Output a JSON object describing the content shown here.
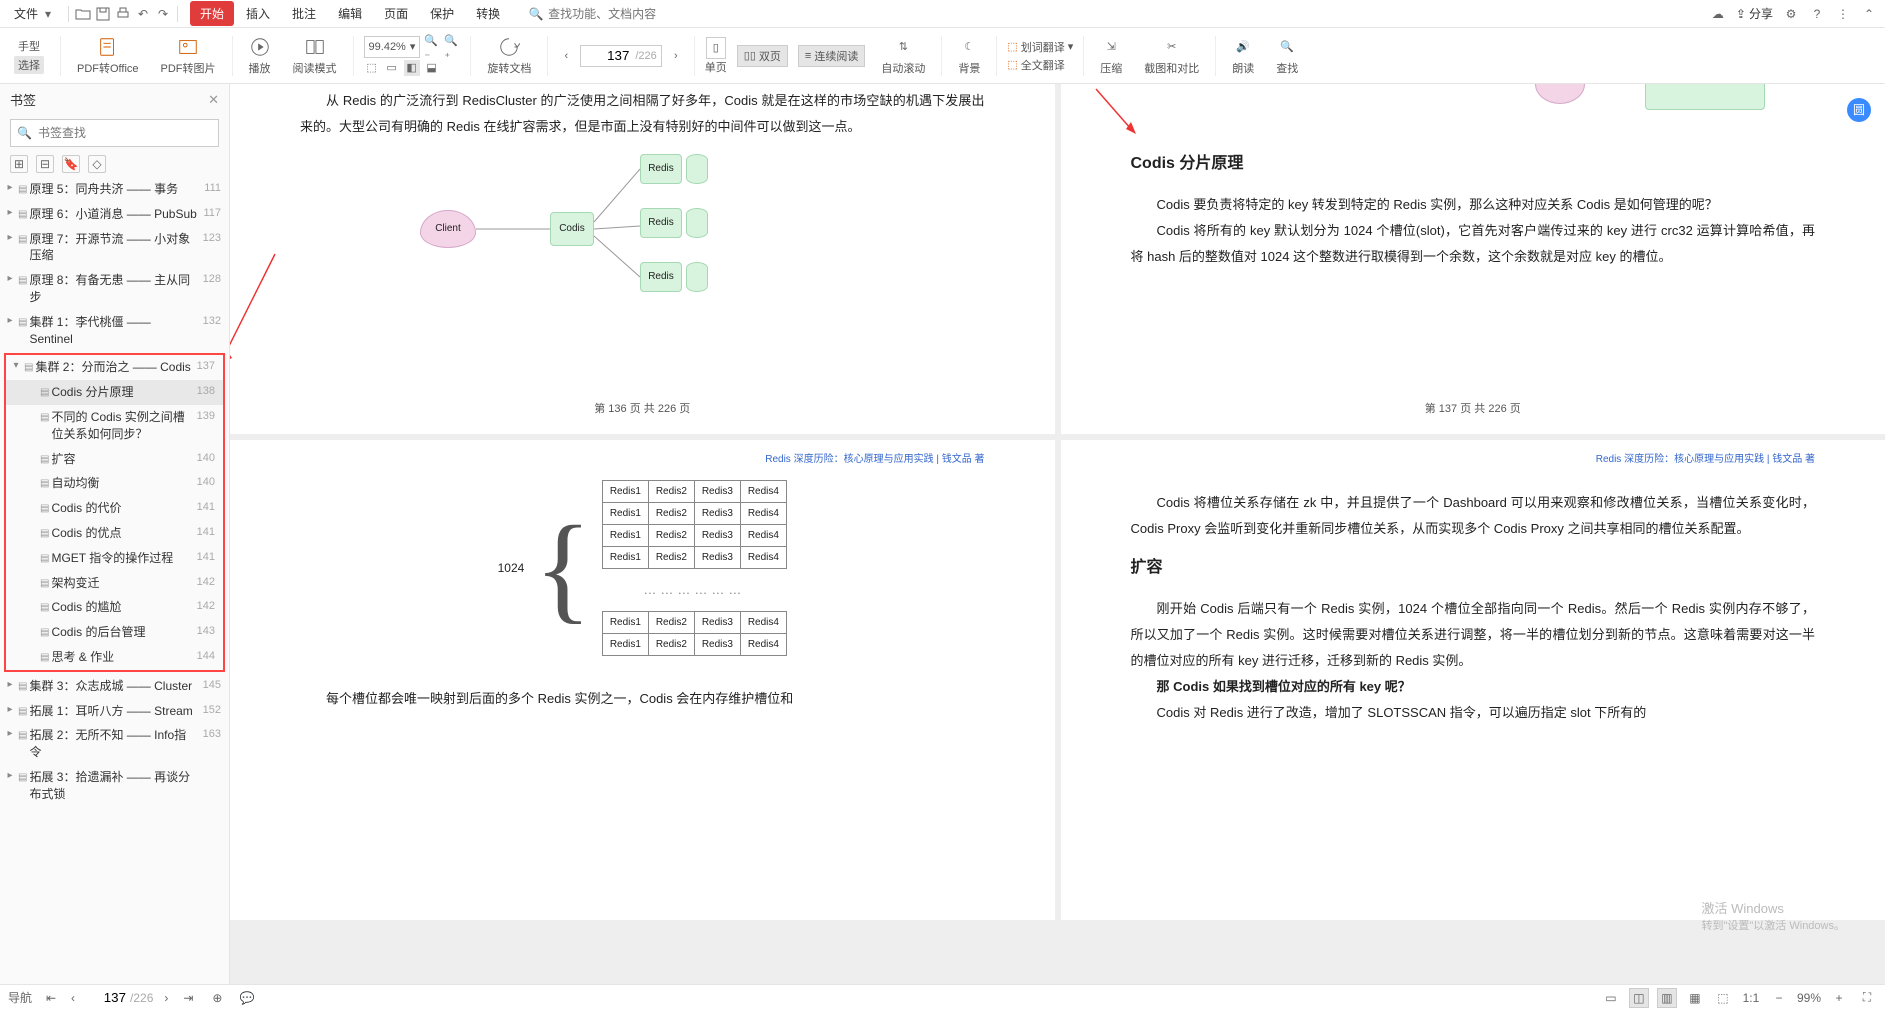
{
  "menu": {
    "file": "文件",
    "tabs": [
      "开始",
      "插入",
      "批注",
      "编辑",
      "页面",
      "保护",
      "转换"
    ],
    "active_tab": 0,
    "search_placeholder": "查找功能、文档内容",
    "share": "分享"
  },
  "ribbon": {
    "hand": "手型",
    "select": "选择",
    "pdf_office": "PDF转Office",
    "pdf_img": "PDF转图片",
    "play": "播放",
    "read_mode": "阅读模式",
    "zoom": "99.42%",
    "rotate": "旋转文档",
    "page_cur": "137",
    "page_total": "/226",
    "single": "单页",
    "double": "双页",
    "cont": "连续阅读",
    "autoscroll": "自动滚动",
    "bg": "背景",
    "word_trans": "划词翻译",
    "full_trans": "全文翻译",
    "compress": "压缩",
    "crop": "截图和对比",
    "read_aloud": "朗读",
    "find": "查找"
  },
  "sidebar": {
    "title": "书签",
    "search_placeholder": "书签查找",
    "items": [
      {
        "t": "原理 5：同舟共济 —— 事务",
        "p": "111",
        "lvl": 1,
        "exp": 0
      },
      {
        "t": "原理 6：小道消息 —— PubSub",
        "p": "117",
        "lvl": 1,
        "exp": 0
      },
      {
        "t": "原理 7：开源节流 —— 小对象压缩",
        "p": "123",
        "lvl": 1,
        "exp": 0
      },
      {
        "t": "原理 8：有备无患 —— 主从同步",
        "p": "128",
        "lvl": 1,
        "exp": 0
      },
      {
        "t": "集群 1：李代桃僵 —— Sentinel",
        "p": "132",
        "lvl": 1,
        "exp": 0
      }
    ],
    "box": [
      {
        "t": "集群 2：分而治之 —— Codis",
        "p": "137",
        "lvl": 1,
        "exp": 1
      },
      {
        "t": "Codis 分片原理",
        "p": "138",
        "lvl": 2,
        "sel": 1
      },
      {
        "t": "不同的 Codis 实例之间槽位关系如何同步？",
        "p": "139",
        "lvl": 2
      },
      {
        "t": "扩容",
        "p": "140",
        "lvl": 2
      },
      {
        "t": "自动均衡",
        "p": "140",
        "lvl": 2
      },
      {
        "t": "Codis 的代价",
        "p": "141",
        "lvl": 2
      },
      {
        "t": "Codis 的优点",
        "p": "141",
        "lvl": 2
      },
      {
        "t": "MGET 指令的操作过程",
        "p": "141",
        "lvl": 2
      },
      {
        "t": "架构变迁",
        "p": "142",
        "lvl": 2
      },
      {
        "t": "Codis 的尴尬",
        "p": "142",
        "lvl": 2
      },
      {
        "t": "Codis 的后台管理",
        "p": "143",
        "lvl": 2
      },
      {
        "t": "思考 & 作业",
        "p": "144",
        "lvl": 2
      }
    ],
    "after": [
      {
        "t": "集群 3：众志成城 —— Cluster",
        "p": "145",
        "lvl": 1,
        "exp": 0
      },
      {
        "t": "拓展 1：耳听八方 —— Stream",
        "p": "152",
        "lvl": 1,
        "exp": 0
      },
      {
        "t": "拓展 2：无所不知 —— Info指令",
        "p": "163",
        "lvl": 1,
        "exp": 0
      },
      {
        "t": "拓展 3：拾遗漏补 —— 再谈分布式锁",
        "p": "",
        "lvl": 1,
        "exp": 0
      }
    ]
  },
  "doc": {
    "header": "Redis 深度历险：核心原理与应用实践  |  钱文品 著",
    "p136": {
      "para": "从 Redis 的广泛流行到 RedisCluster 的广泛使用之间相隔了好多年，Codis 就是在这样的市场空缺的机遇下发展出来的。大型公司有明确的 Redis 在线扩容需求，但是市面上没有特别好的中间件可以做到这一点。",
      "client": "Client",
      "codis": "Codis",
      "redis": "Redis",
      "footer": "第 136 页 共 226 页"
    },
    "p137": {
      "title": "Codis 分片原理",
      "para1": "Codis 要负责将特定的 key 转发到特定的 Redis 实例，那么这种对应关系 Codis 是如何管理的呢？",
      "para2": "Codis 将所有的 key 默认划分为 1024 个槽位(slot)，它首先对客户端传过来的 key 进行 crc32 运算计算哈希值，再将 hash 后的整数值对 1024 这个整数进行取模得到一个余数，这个余数就是对应 key 的槽位。",
      "footer": "第 137 页 共 226 页"
    },
    "p138": {
      "label": "1024",
      "cells": [
        "Redis1",
        "Redis2",
        "Redis3",
        "Redis4"
      ],
      "footer_text": "每个槽位都会唯一映射到后面的多个 Redis 实例之一，Codis 会在内存维护槽位和"
    },
    "p139": {
      "para1": "Codis 将槽位关系存储在 zk 中，并且提供了一个 Dashboard 可以用来观察和修改槽位关系，当槽位关系变化时，Codis Proxy 会监听到变化并重新同步槽位关系，从而实现多个 Codis Proxy 之间共享相同的槽位关系配置。",
      "title": "扩容",
      "para2": "刚开始 Codis 后端只有一个 Redis 实例，1024 个槽位全部指向同一个 Redis。然后一个 Redis 实例内存不够了，所以又加了一个 Redis 实例。这时候需要对槽位关系进行调整，将一半的槽位划分到新的节点。这意味着需要对这一半的槽位对应的所有 key 进行迁移，迁移到新的 Redis 实例。",
      "q": "那 Codis 如果找到槽位对应的所有 key 呢？",
      "para3": "Codis 对 Redis 进行了改造，增加了 SLOTSSCAN 指令，可以遍历指定 slot 下所有的"
    }
  },
  "status": {
    "label": "导航",
    "page_cur": "137",
    "page_total": "/226",
    "zoom": "99%"
  },
  "watermark": {
    "l1": "激活 Windows",
    "l2": "转到\"设置\"以激活 Windows。"
  }
}
